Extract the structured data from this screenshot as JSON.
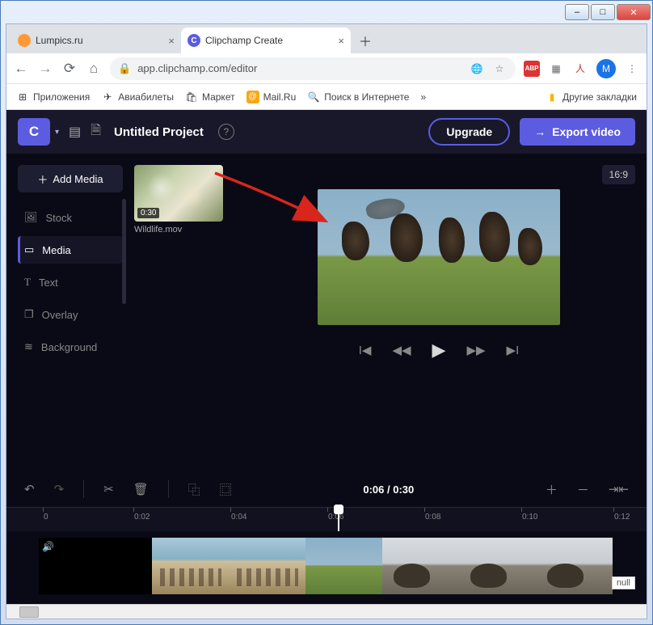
{
  "window": {
    "tabs": [
      {
        "title": "Lumpics.ru",
        "active": false,
        "fav_bg": "#ff9933",
        "fav_txt": ""
      },
      {
        "title": "Clipchamp Create",
        "active": true,
        "fav_bg": "#5c5ce0",
        "fav_txt": "C"
      }
    ],
    "url": "app.clipchamp.com/editor",
    "avatar_letter": "M"
  },
  "bookmarks": [
    {
      "label": "Приложения",
      "ico": "⊞"
    },
    {
      "label": "Авиабилеты",
      "ico": "✈"
    },
    {
      "label": "Маркет",
      "ico": "🛍"
    },
    {
      "label": "Mail.Ru",
      "ico": "@"
    },
    {
      "label": "Поиск в Интернете",
      "ico": "🔍"
    },
    {
      "label": "»",
      "ico": ""
    },
    {
      "label": "Другие закладки",
      "ico": "📁"
    }
  ],
  "app": {
    "logo_letter": "C",
    "project_title": "Untitled Project",
    "upgrade_label": "Upgrade",
    "export_label": "Export video"
  },
  "sidebar": {
    "add_media_label": "Add Media",
    "items": [
      {
        "label": "Stock",
        "ico": "🖼",
        "active": false
      },
      {
        "label": "Media",
        "ico": "▭",
        "active": true
      },
      {
        "label": "Text",
        "ico": "T",
        "active": false
      },
      {
        "label": "Overlay",
        "ico": "❐",
        "active": false
      },
      {
        "label": "Background",
        "ico": "≋",
        "active": false
      }
    ]
  },
  "media": {
    "thumb_duration": "0:30",
    "thumb_name": "Wildlife.mov"
  },
  "preview": {
    "aspect_ratio": "16:9"
  },
  "timeline": {
    "time_display": "0:06 / 0:30",
    "ticks": [
      "0",
      "0:02",
      "0:04",
      "0:06",
      "0:08",
      "0:10",
      "0:12"
    ]
  },
  "misc": {
    "null_text": "null"
  }
}
